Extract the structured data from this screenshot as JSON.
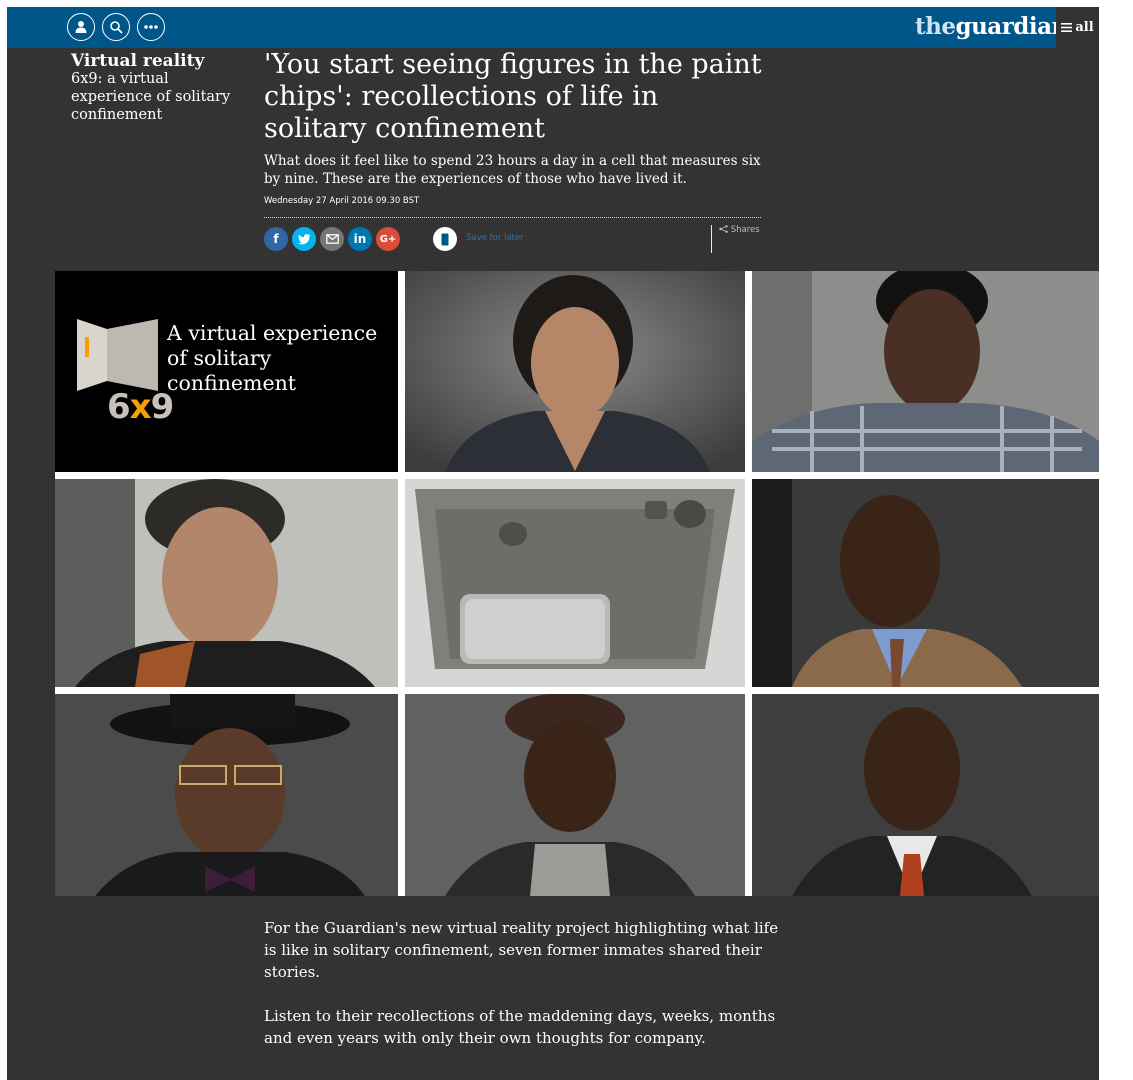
{
  "header": {
    "logo_prefix": "the",
    "logo_main": "guardian",
    "menu_label": "all",
    "icons": [
      "profile-icon",
      "search-icon",
      "more-icon",
      "menu-icon"
    ]
  },
  "article": {
    "section": "Virtual reality",
    "series": "6x9: a virtual experience of solitary confinement",
    "headline": "'You start seeing figures in the paint chips': recollections of life in solitary confinement",
    "standfirst": "What does it feel like to spend 23 hours a day in a cell that measures six by nine. These are the experiences of those who have lived it.",
    "date": "Wednesday 27 April 2016 09.30 BST"
  },
  "share": {
    "buttons": [
      {
        "name": "facebook",
        "glyph": "f",
        "color": "#3067a3"
      },
      {
        "name": "twitter",
        "glyph": "t",
        "color": "#03b3ee"
      },
      {
        "name": "email",
        "glyph": "✉",
        "color": "#767676"
      },
      {
        "name": "linkedin",
        "glyph": "in",
        "color": "#0077b5"
      },
      {
        "name": "googleplus",
        "glyph": "G+",
        "color": "#dd4b39"
      }
    ],
    "save_label": "Save for later",
    "shares_label": "Shares"
  },
  "promo": {
    "tagline_line1": "A virtual experience",
    "tagline_line2": "of solitary confinement",
    "logo_left": "6",
    "logo_x": "x",
    "logo_right": "9"
  },
  "colors": {
    "masthead": "#005689",
    "page_bg": "#333333",
    "promo_orange": "#f5a000"
  },
  "body": [
    "For the Guardian's new virtual reality project highlighting what life is like in solitary confinement, seven former inmates shared their stories.",
    "Listen to their recollections of the maddening days, weeks, months and even years with only their own thoughts for company."
  ]
}
